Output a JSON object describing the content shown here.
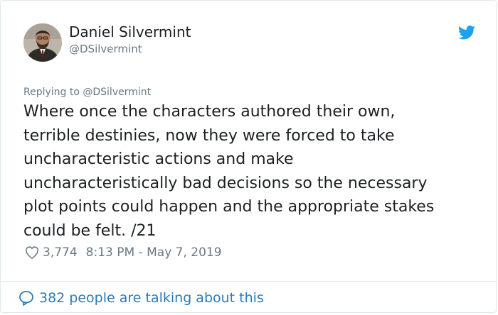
{
  "author": {
    "display_name": "Daniel Silvermint",
    "handle": "@DSilvermint",
    "avatar_icon": "person-avatar"
  },
  "tweet": {
    "replying_to": "Replying to @DSilvermint",
    "text": "Where once the characters authored their own,\nterrible destinies, now they were forced to take\nuncharacteristic actions and make\nuncharacteristically bad decisions so the necessary\nplot points could happen and the appropriate stakes\ncould be felt.  /21",
    "likes": "3,774",
    "timestamp": "8:13 PM - May 7, 2019"
  },
  "footer": {
    "talking_label": "382 people are talking about this"
  },
  "icons": {
    "brand": "twitter-bird-icon",
    "like": "heart-icon",
    "conversation": "speech-bubble-icon"
  },
  "colors": {
    "twitter_blue": "#1da1f2",
    "link_blue": "#2b7bb9",
    "secondary_gray": "#697882",
    "text": "#1c2022",
    "border": "#e1e8ed"
  }
}
